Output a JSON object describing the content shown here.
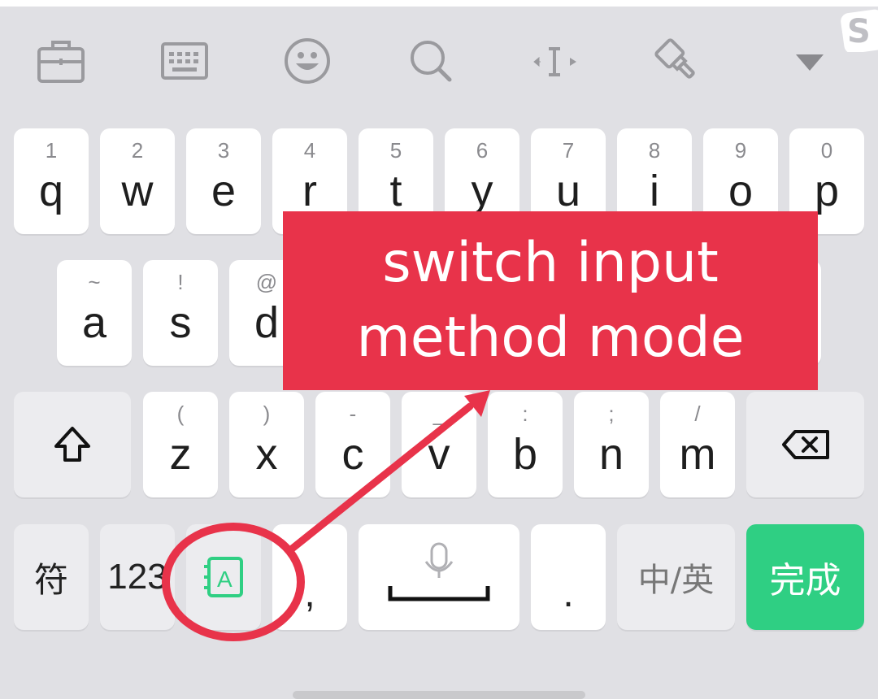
{
  "toolbar": {
    "icons": [
      "briefcase-icon",
      "keyboard-icon",
      "emoji-icon",
      "search-icon",
      "cursor-icon",
      "clear-brush-icon",
      "collapse-icon"
    ]
  },
  "rows": {
    "row1": [
      {
        "hint": "1",
        "main": "q"
      },
      {
        "hint": "2",
        "main": "w"
      },
      {
        "hint": "3",
        "main": "e"
      },
      {
        "hint": "4",
        "main": "r"
      },
      {
        "hint": "5",
        "main": "t"
      },
      {
        "hint": "6",
        "main": "y"
      },
      {
        "hint": "7",
        "main": "u"
      },
      {
        "hint": "8",
        "main": "i"
      },
      {
        "hint": "9",
        "main": "o"
      },
      {
        "hint": "0",
        "main": "p"
      }
    ],
    "row2": [
      {
        "hint": "~",
        "main": "a"
      },
      {
        "hint": "!",
        "main": "s"
      },
      {
        "hint": "@",
        "main": "d"
      }
    ],
    "row3": [
      {
        "hint": "(",
        "main": "z"
      },
      {
        "hint": ")",
        "main": "x"
      },
      {
        "hint": "-",
        "main": "c"
      },
      {
        "hint": "_",
        "main": "v"
      },
      {
        "hint": ":",
        "main": "b"
      },
      {
        "hint": ";",
        "main": "n"
      },
      {
        "hint": "/",
        "main": "m"
      }
    ]
  },
  "bottom": {
    "symbols_label": "符",
    "numbers_label": "123",
    "comma_label": ",",
    "period_label": ".",
    "lang_label": "中/英",
    "done_label": "完成",
    "mode_icon": "input-mode-icon",
    "mic_icon": "microphone-icon"
  },
  "annotation": {
    "line1": "switch input",
    "line2": "method mode",
    "color": "#e8334a"
  },
  "colors": {
    "accent": "#2fcf83",
    "keyboard_bg": "#e0e0e4",
    "annotation": "#e8334a"
  }
}
